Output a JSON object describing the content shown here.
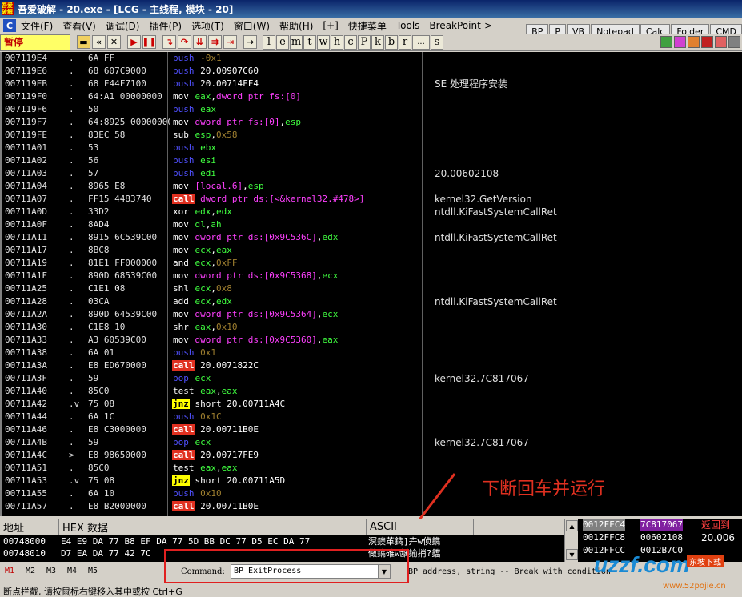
{
  "window": {
    "app_icon_text": "吾爱破解",
    "title": "吾爱破解 - 20.exe - [LCG - 主线程, 模块 - 20]"
  },
  "menu": {
    "sys_icon": "C",
    "items": [
      "文件(F)",
      "查看(V)",
      "调试(D)",
      "插件(P)",
      "选项(T)",
      "窗口(W)",
      "帮助(H)",
      "[+]",
      "快捷菜单",
      "Tools",
      "BreakPoint->"
    ]
  },
  "quick_buttons": [
    "BP",
    "P",
    "VB",
    "Notepad",
    "Calc",
    "Folder",
    "CMD"
  ],
  "toolbar": {
    "status": "暂停",
    "letters": [
      "l",
      "e",
      "m",
      "t",
      "w",
      "h",
      "c",
      "P",
      "k",
      "b",
      "r",
      "...",
      "s"
    ]
  },
  "disasm": [
    {
      "addr": "007119E4",
      "mark": ".",
      "hex": "6A FF",
      "mn": "push",
      "ops": [
        [
          "imm",
          "-0x1"
        ]
      ],
      "cmt": ""
    },
    {
      "addr": "007119E6",
      "mark": ".",
      "hex": "68 607C9000",
      "mn": "push",
      "ops": [
        [
          "plain",
          "20.00907C60"
        ]
      ],
      "cmt": ""
    },
    {
      "addr": "007119EB",
      "mark": ".",
      "hex": "68 F44F7100",
      "mn": "push",
      "ops": [
        [
          "plain",
          "20.00714FF4"
        ]
      ],
      "cmt": "SE 处理程序安装"
    },
    {
      "addr": "007119F0",
      "mark": ".",
      "hex": "64:A1 00000000",
      "mn": "mov",
      "ops": [
        [
          "reg",
          "eax"
        ],
        [
          "plain",
          ","
        ],
        [
          "mem",
          "dword ptr fs:[0]"
        ]
      ],
      "cmt": ""
    },
    {
      "addr": "007119F6",
      "mark": ".",
      "hex": "50",
      "mn": "push",
      "ops": [
        [
          "reg",
          "eax"
        ]
      ],
      "cmt": ""
    },
    {
      "addr": "007119F7",
      "mark": ".",
      "hex": "64:8925 00000000",
      "mn": "mov",
      "ops": [
        [
          "mem",
          "dword ptr fs:[0]"
        ],
        [
          "plain",
          ","
        ],
        [
          "reg",
          "esp"
        ]
      ],
      "cmt": ""
    },
    {
      "addr": "007119FE",
      "mark": ".",
      "hex": "83EC 58",
      "mn": "sub",
      "ops": [
        [
          "reg",
          "esp"
        ],
        [
          "plain",
          ","
        ],
        [
          "imm",
          "0x58"
        ]
      ],
      "cmt": ""
    },
    {
      "addr": "00711A01",
      "mark": ".",
      "hex": "53",
      "mn": "push",
      "ops": [
        [
          "reg",
          "ebx"
        ]
      ],
      "cmt": ""
    },
    {
      "addr": "00711A02",
      "mark": ".",
      "hex": "56",
      "mn": "push",
      "ops": [
        [
          "reg",
          "esi"
        ]
      ],
      "cmt": ""
    },
    {
      "addr": "00711A03",
      "mark": ".",
      "hex": "57",
      "mn": "push",
      "ops": [
        [
          "reg",
          "edi"
        ]
      ],
      "cmt": "20.00602108"
    },
    {
      "addr": "00711A04",
      "mark": ".",
      "hex": "8965 E8",
      "mn": "mov",
      "ops": [
        [
          "mem",
          "[local.6]"
        ],
        [
          "plain",
          ","
        ],
        [
          "reg",
          "esp"
        ]
      ],
      "cmt": ""
    },
    {
      "addr": "00711A07",
      "mark": ".",
      "hex": "FF15 4483740",
      "mn": "call",
      "ops": [
        [
          "mem",
          "dword ptr ds:[<&kernel32.#478>]"
        ]
      ],
      "cmt": "kernel32.GetVersion"
    },
    {
      "addr": "00711A0D",
      "mark": ".",
      "hex": "33D2",
      "mn": "xor",
      "ops": [
        [
          "reg",
          "edx"
        ],
        [
          "plain",
          ","
        ],
        [
          "reg",
          "edx"
        ]
      ],
      "cmt": "ntdll.KiFastSystemCallRet"
    },
    {
      "addr": "00711A0F",
      "mark": ".",
      "hex": "8AD4",
      "mn": "mov",
      "ops": [
        [
          "reg",
          "dl"
        ],
        [
          "plain",
          ","
        ],
        [
          "reg",
          "ah"
        ]
      ],
      "cmt": ""
    },
    {
      "addr": "00711A11",
      "mark": ".",
      "hex": "8915 6C539C00",
      "mn": "mov",
      "ops": [
        [
          "mem",
          "dword ptr ds:[0x9C536C]"
        ],
        [
          "plain",
          ","
        ],
        [
          "reg",
          "edx"
        ]
      ],
      "cmt": "ntdll.KiFastSystemCallRet"
    },
    {
      "addr": "00711A17",
      "mark": ".",
      "hex": "8BC8",
      "mn": "mov",
      "ops": [
        [
          "reg",
          "ecx"
        ],
        [
          "plain",
          ","
        ],
        [
          "reg",
          "eax"
        ]
      ],
      "cmt": ""
    },
    {
      "addr": "00711A19",
      "mark": ".",
      "hex": "81E1 FF000000",
      "mn": "and",
      "ops": [
        [
          "reg",
          "ecx"
        ],
        [
          "plain",
          ","
        ],
        [
          "imm",
          "0xFF"
        ]
      ],
      "cmt": ""
    },
    {
      "addr": "00711A1F",
      "mark": ".",
      "hex": "890D 68539C00",
      "mn": "mov",
      "ops": [
        [
          "mem",
          "dword ptr ds:[0x9C5368]"
        ],
        [
          "plain",
          ","
        ],
        [
          "reg",
          "ecx"
        ]
      ],
      "cmt": ""
    },
    {
      "addr": "00711A25",
      "mark": ".",
      "hex": "C1E1 08",
      "mn": "shl",
      "ops": [
        [
          "reg",
          "ecx"
        ],
        [
          "plain",
          ","
        ],
        [
          "imm",
          "0x8"
        ]
      ],
      "cmt": ""
    },
    {
      "addr": "00711A28",
      "mark": ".",
      "hex": "03CA",
      "mn": "add",
      "ops": [
        [
          "reg",
          "ecx"
        ],
        [
          "plain",
          ","
        ],
        [
          "reg",
          "edx"
        ]
      ],
      "cmt": "ntdll.KiFastSystemCallRet"
    },
    {
      "addr": "00711A2A",
      "mark": ".",
      "hex": "890D 64539C00",
      "mn": "mov",
      "ops": [
        [
          "mem",
          "dword ptr ds:[0x9C5364]"
        ],
        [
          "plain",
          ","
        ],
        [
          "reg",
          "ecx"
        ]
      ],
      "cmt": ""
    },
    {
      "addr": "00711A30",
      "mark": ".",
      "hex": "C1E8 10",
      "mn": "shr",
      "ops": [
        [
          "reg",
          "eax"
        ],
        [
          "plain",
          ","
        ],
        [
          "imm",
          "0x10"
        ]
      ],
      "cmt": ""
    },
    {
      "addr": "00711A33",
      "mark": ".",
      "hex": "A3 60539C00",
      "mn": "mov",
      "ops": [
        [
          "mem",
          "dword ptr ds:[0x9C5360]"
        ],
        [
          "plain",
          ","
        ],
        [
          "reg",
          "eax"
        ]
      ],
      "cmt": ""
    },
    {
      "addr": "00711A38",
      "mark": ".",
      "hex": "6A 01",
      "mn": "push",
      "ops": [
        [
          "imm",
          "0x1"
        ]
      ],
      "cmt": ""
    },
    {
      "addr": "00711A3A",
      "mark": ".",
      "hex": "E8 ED670000",
      "mn": "call",
      "ops": [
        [
          "plain",
          "20.0071822C"
        ]
      ],
      "cmt": ""
    },
    {
      "addr": "00711A3F",
      "mark": ".",
      "hex": "59",
      "mn": "pop",
      "ops": [
        [
          "reg",
          "ecx"
        ]
      ],
      "cmt": "kernel32.7C817067"
    },
    {
      "addr": "00711A40",
      "mark": ".",
      "hex": "85C0",
      "mn": "test",
      "ops": [
        [
          "reg",
          "eax"
        ],
        [
          "plain",
          ","
        ],
        [
          "reg",
          "eax"
        ]
      ],
      "cmt": ""
    },
    {
      "addr": "00711A42",
      "mark": ".v",
      "hex": "75 08",
      "mn": "jnz",
      "ops": [
        [
          "plain",
          "short 20.00711A4C"
        ]
      ],
      "cmt": ""
    },
    {
      "addr": "00711A44",
      "mark": ".",
      "hex": "6A 1C",
      "mn": "push",
      "ops": [
        [
          "imm",
          "0x1C"
        ]
      ],
      "cmt": ""
    },
    {
      "addr": "00711A46",
      "mark": ".",
      "hex": "E8 C3000000",
      "mn": "call",
      "ops": [
        [
          "plain",
          "20.00711B0E"
        ]
      ],
      "cmt": ""
    },
    {
      "addr": "00711A4B",
      "mark": ".",
      "hex": "59",
      "mn": "pop",
      "ops": [
        [
          "reg",
          "ecx"
        ]
      ],
      "cmt": "kernel32.7C817067"
    },
    {
      "addr": "00711A4C",
      "mark": ">",
      "hex": "E8 98650000",
      "mn": "call",
      "ops": [
        [
          "plain",
          "20.00717FE9"
        ]
      ],
      "cmt": ""
    },
    {
      "addr": "00711A51",
      "mark": ".",
      "hex": "85C0",
      "mn": "test",
      "ops": [
        [
          "reg",
          "eax"
        ],
        [
          "plain",
          ","
        ],
        [
          "reg",
          "eax"
        ]
      ],
      "cmt": ""
    },
    {
      "addr": "00711A53",
      "mark": ".v",
      "hex": "75 08",
      "mn": "jnz",
      "ops": [
        [
          "plain",
          "short 20.00711A5D"
        ]
      ],
      "cmt": ""
    },
    {
      "addr": "00711A55",
      "mark": ".",
      "hex": "6A 10",
      "mn": "push",
      "ops": [
        [
          "imm",
          "0x10"
        ]
      ],
      "cmt": ""
    },
    {
      "addr": "00711A57",
      "mark": ".",
      "hex": "E8 B2000000",
      "mn": "call",
      "ops": [
        [
          "plain",
          "20.00711B0E"
        ]
      ],
      "cmt": ""
    }
  ],
  "annotation": "下断回车并运行",
  "dump": {
    "headers": [
      "地址",
      "HEX 数据",
      "ASCII"
    ],
    "rows": [
      {
        "addr": "00748000",
        "hex": "E4 E9 DA 77 B8 EF DA 77 5D BB DC 77 D5 EC DA 77",
        "ascii": "溟鐭革鐫]卉w侦鐫"
      },
      {
        "addr": "00748010",
        "hex": "D7 EA DA 77 42 7C",
        "ascii": "做鐫碓w龋鍮捎?鐺"
      }
    ]
  },
  "stack": [
    {
      "addr": "0012FFC4",
      "val": "7C817067",
      "cmt": "返回到",
      "hl": true
    },
    {
      "addr": "0012FFC8",
      "val": "00602108",
      "cmt": "20.006",
      "hl": false
    },
    {
      "addr": "0012FFCC",
      "val": "0012B7C0",
      "cmt": "",
      "hl": false
    }
  ],
  "command": {
    "tabs": [
      "M1",
      "M2",
      "M3",
      "M4",
      "M5"
    ],
    "label": "Command:",
    "value": "BP ExitProcess",
    "hint": "BP address, string -- Break with condition"
  },
  "status_text": "断点拦截, 请按鼠标右键移入其中或按 Ctrl+G",
  "watermark": {
    "brand": "uzzf.com",
    "badge": "东坡下载",
    "sub": "www.52pojie.cn"
  }
}
